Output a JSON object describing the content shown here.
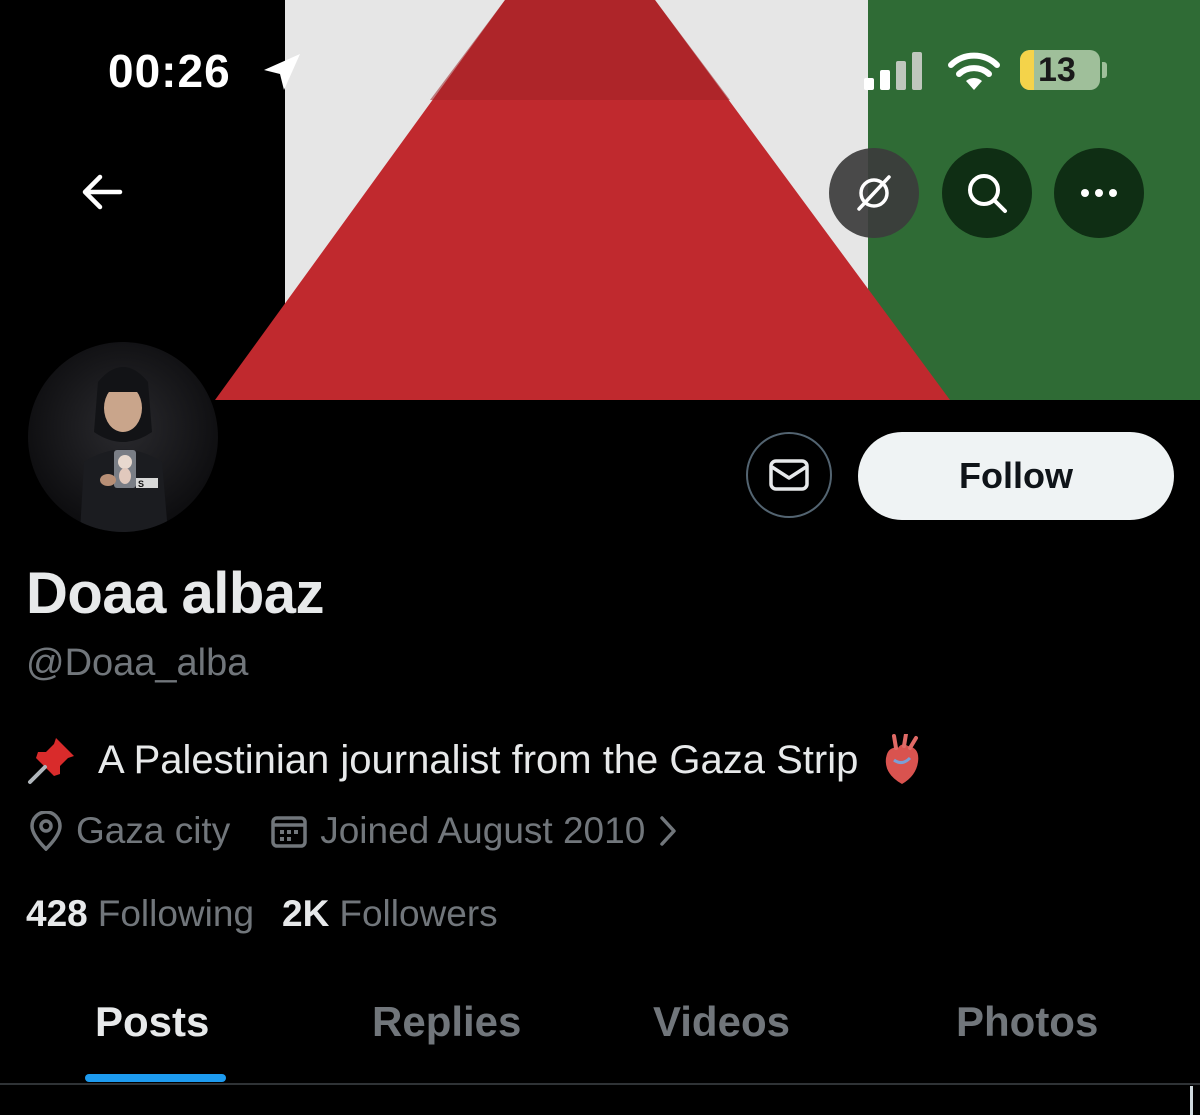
{
  "status_bar": {
    "time": "00:26",
    "battery": "13"
  },
  "header": {
    "back_icon": "arrow-left-icon",
    "grok_icon": "grok-icon",
    "search_icon": "search-icon",
    "more_icon": "ellipsis-icon"
  },
  "banner": {
    "colors": {
      "black": "#000000",
      "white": "#e9e9e9",
      "green": "#2f6b35",
      "red": "#c12a2f"
    }
  },
  "profile": {
    "display_name": "Doaa albaz",
    "handle": "@Doaa_alba",
    "bio": "A Palestinian journalist from the Gaza Strip",
    "location": "Gaza city",
    "joined": "Joined August 2010",
    "following_count": "428",
    "following_label": "Following",
    "followers_count": "2K",
    "followers_label": "Followers"
  },
  "actions": {
    "follow_label": "Follow",
    "message_icon": "envelope-icon"
  },
  "tabs": [
    {
      "label": "Posts",
      "active": true
    },
    {
      "label": "Replies",
      "active": false
    },
    {
      "label": "Videos",
      "active": false
    },
    {
      "label": "Photos",
      "active": false
    }
  ],
  "colors": {
    "accent": "#1d9bf0",
    "text_primary": "#e7e9ea",
    "text_secondary": "#71767b",
    "follow_bg": "#eff3f4"
  }
}
